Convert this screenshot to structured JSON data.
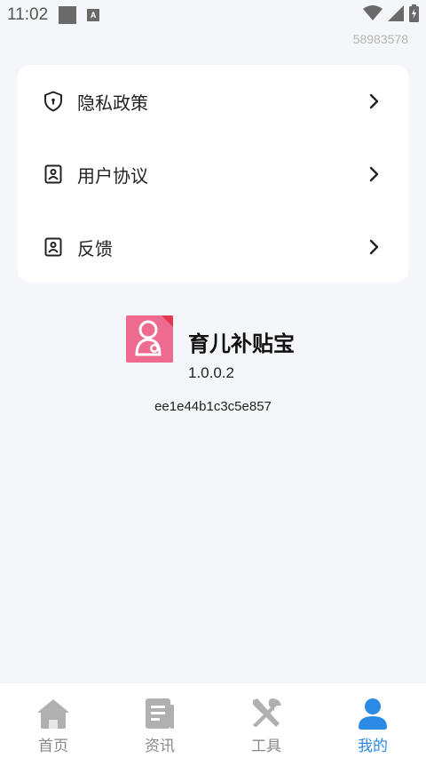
{
  "status_bar": {
    "time": "11:02",
    "icons": [
      "notification-square-icon",
      "a-icon",
      "wifi-icon",
      "signal-icon",
      "battery-icon"
    ]
  },
  "user_id": "58983578",
  "menu": {
    "items": [
      {
        "label": "隐私政策",
        "icon": "shield-icon"
      },
      {
        "label": "用户协议",
        "icon": "document-icon"
      },
      {
        "label": "反馈",
        "icon": "feedback-icon"
      }
    ]
  },
  "app": {
    "name": "育儿补贴宝",
    "version": "1.0.0.2",
    "hash": "ee1e44b1c3c5e857"
  },
  "bottom_nav": {
    "tabs": [
      {
        "label": "首页",
        "icon": "home-icon"
      },
      {
        "label": "资讯",
        "icon": "news-icon"
      },
      {
        "label": "工具",
        "icon": "tools-icon"
      },
      {
        "label": "我的",
        "icon": "user-icon"
      }
    ],
    "active_index": 3
  },
  "colors": {
    "accent": "#2a8ae5",
    "inactive": "#b0b0b0",
    "logo": "#ee6b8f",
    "background": "#f5f6fa"
  }
}
